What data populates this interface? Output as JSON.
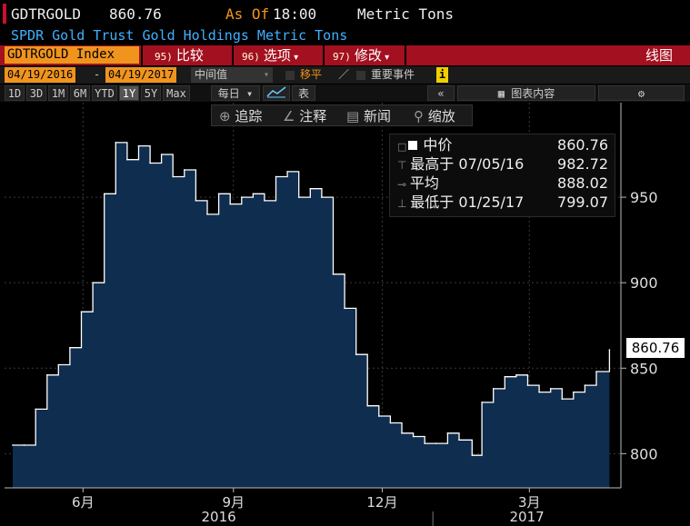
{
  "header": {
    "ticker": "GDTRGOLD",
    "price": "860.76",
    "as_of_label": "As Of",
    "time": "18:00",
    "unit": "Metric Tons",
    "description": "SPDR Gold Trust Gold Holdings Metric Tons"
  },
  "toolbar": {
    "security": "GDTRGOLD Index",
    "compare_num": "95)",
    "compare_label": "比较",
    "options_num": "96)",
    "options_label": "选项",
    "edit_num": "97)",
    "edit_label": "修改",
    "line_chart_label": "线图"
  },
  "range_bar": {
    "start_date": "04/19/2016",
    "dash": "-",
    "end_date": "04/19/2017",
    "price_type": "中间值",
    "move_label": "移平",
    "events_label": "重要事件"
  },
  "periods": {
    "items": [
      "1D",
      "3D",
      "1M",
      "6M",
      "YTD",
      "1Y",
      "5Y",
      "Max"
    ],
    "selected": "1Y",
    "frequency": "每日",
    "table_label": "表",
    "chart_content_label": "图表内容"
  },
  "chart_toolbar": {
    "track_label": "追踪",
    "annotate_label": "注释",
    "news_label": "新闻",
    "zoom_label": "缩放"
  },
  "legend": {
    "mid_label": "中价",
    "mid_value": "860.76",
    "high_label": "最高于",
    "high_date": "07/05/16",
    "high_value": "982.72",
    "avg_label": "平均",
    "avg_value": "888.02",
    "low_label": "最低于",
    "low_date": "01/25/17",
    "low_value": "799.07"
  },
  "last_value_label": "860.76",
  "colors": {
    "accent": "#f0941e",
    "toolbar_red": "#a3101f",
    "area_fill": "#0f2d4e",
    "line": "#ffffff",
    "description_blue": "#3fb1ff"
  },
  "chart_data": {
    "type": "area",
    "title": "",
    "xlabel": "",
    "ylabel": "Metric Tons",
    "ylim": [
      780,
      1000
    ],
    "y_ticks": [
      "800",
      "850",
      "900",
      "950"
    ],
    "y_tick_values": [
      800,
      850,
      900,
      950
    ],
    "x_month_labels": [
      "6月",
      "9月",
      "12月",
      "3月"
    ],
    "x_month_dates": [
      "2016-06-01",
      "2016-09-01",
      "2016-12-01",
      "2017-03-01"
    ],
    "x_year_labels": [
      "2016",
      "2017"
    ],
    "grid": true,
    "series": [
      {
        "x": [
          "2016-04-19",
          "2016-04-26",
          "2016-05-03",
          "2016-05-10",
          "2016-05-17",
          "2016-05-24",
          "2016-05-31",
          "2016-06-07",
          "2016-06-14",
          "2016-06-21",
          "2016-06-28",
          "2016-07-05",
          "2016-07-12",
          "2016-07-19",
          "2016-07-26",
          "2016-08-02",
          "2016-08-09",
          "2016-08-16",
          "2016-08-23",
          "2016-08-30",
          "2016-09-06",
          "2016-09-13",
          "2016-09-20",
          "2016-09-27",
          "2016-10-04",
          "2016-10-11",
          "2016-10-18",
          "2016-10-25",
          "2016-11-01",
          "2016-11-08",
          "2016-11-15",
          "2016-11-22",
          "2016-11-29",
          "2016-12-06",
          "2016-12-13",
          "2016-12-20",
          "2016-12-27",
          "2017-01-03",
          "2017-01-10",
          "2017-01-17",
          "2017-01-25",
          "2017-01-31",
          "2017-02-07",
          "2017-02-14",
          "2017-02-21",
          "2017-02-28",
          "2017-03-07",
          "2017-03-14",
          "2017-03-21",
          "2017-03-28",
          "2017-04-04",
          "2017-04-11",
          "2017-04-19"
        ],
        "values": [
          805,
          805,
          826,
          846,
          852,
          862,
          883,
          900,
          952,
          982,
          972,
          980,
          970,
          975,
          962,
          966,
          948,
          940,
          952,
          946,
          950,
          952,
          948,
          962,
          965,
          950,
          955,
          950,
          905,
          885,
          858,
          828,
          822,
          818,
          812,
          810,
          806,
          806,
          812,
          808,
          799,
          830,
          838,
          845,
          846,
          840,
          836,
          838,
          832,
          836,
          840,
          848,
          860.76
        ]
      }
    ]
  }
}
